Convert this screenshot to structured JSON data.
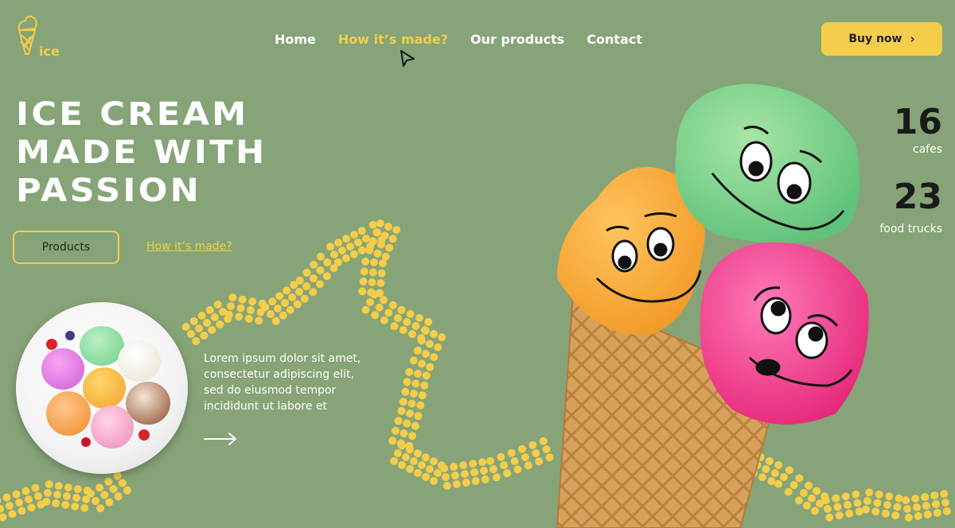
{
  "brand": {
    "logo_text": "ice"
  },
  "nav": {
    "items": [
      {
        "label": "Home",
        "active": false
      },
      {
        "label": "How it’s made?",
        "active": true
      },
      {
        "label": "Our products",
        "active": false
      },
      {
        "label": "Contact",
        "active": false
      }
    ]
  },
  "header": {
    "buy_label": "Buy now",
    "buy_icon": "chevron-right-icon"
  },
  "hero": {
    "headline_lines": [
      "ICE CREAM",
      "MADE WITH",
      "PASSION"
    ],
    "products_button": "Products",
    "how_link": "How it’s made?",
    "description_lines": [
      "Lorem ipsum dolor sit amet,",
      "consectetur adipiscing elit,",
      "sed do eiusmod tempor",
      "incididunt ut labore et"
    ],
    "arrow_icon": "arrow-right-icon"
  },
  "stats": [
    {
      "value": "16",
      "label": "cafes"
    },
    {
      "value": "23",
      "label": "food trucks"
    }
  ],
  "colors": {
    "background": "#86a477",
    "accent": "#f4cd4b",
    "text_light": "#ffffff",
    "text_dark": "#1a1a1a"
  }
}
